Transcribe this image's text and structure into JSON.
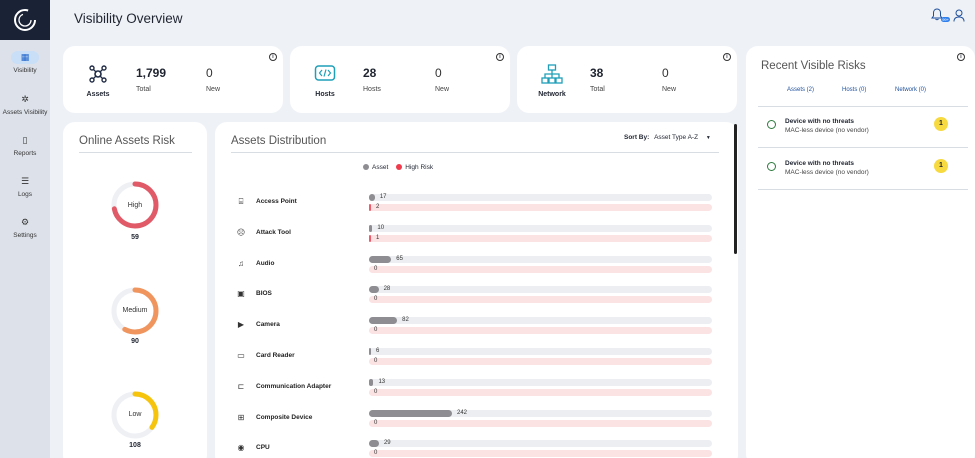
{
  "page": {
    "title": "Visibility Overview"
  },
  "sidebar": {
    "items": [
      {
        "label": "Visibility",
        "icon": "grid-icon"
      },
      {
        "label": "Assets Visibility",
        "icon": "asterisk-icon"
      },
      {
        "label": "Reports",
        "icon": "document-icon"
      },
      {
        "label": "Logs",
        "icon": "list-check-icon"
      },
      {
        "label": "Settings",
        "icon": "sliders-icon"
      }
    ]
  },
  "stats": [
    {
      "label": "Assets",
      "value": "1,799",
      "value_caption": "Total",
      "new_value": "0",
      "new_caption": "New"
    },
    {
      "label": "Hosts",
      "value": "28",
      "value_caption": "Hosts",
      "new_value": "0",
      "new_caption": "New"
    },
    {
      "label": "Network",
      "value": "38",
      "value_caption": "Total",
      "new_value": "0",
      "new_caption": "New"
    }
  ],
  "online_risk": {
    "title": "Online Assets Risk",
    "levels": [
      {
        "label": "High",
        "value": "59",
        "color": "#e05a67",
        "fraction": 0.72
      },
      {
        "label": "Medium",
        "value": "90",
        "color": "#f0955e",
        "fraction": 0.58
      },
      {
        "label": "Low",
        "value": "108",
        "color": "#f6c40d",
        "fraction": 0.35
      }
    ]
  },
  "distribution": {
    "title": "Assets Distribution",
    "sort_label": "Sort By:",
    "sort_value": "Asset Type A-Z",
    "legend": [
      {
        "label": "Asset",
        "color": "#8e8e92"
      },
      {
        "label": "High Risk",
        "color": "#ef3b4b"
      }
    ],
    "max_value": 1000,
    "rows": [
      {
        "name": "Access Point",
        "icon": "router-icon",
        "asset": "17",
        "risk": "2"
      },
      {
        "name": "Attack Tool",
        "icon": "hacker-icon",
        "asset": "10",
        "risk": "1"
      },
      {
        "name": "Audio",
        "icon": "headphones-icon",
        "asset": "65",
        "risk": "0"
      },
      {
        "name": "BIOS",
        "icon": "chip-icon",
        "asset": "28",
        "risk": "0"
      },
      {
        "name": "Camera",
        "icon": "camera-icon",
        "asset": "82",
        "risk": "0"
      },
      {
        "name": "Card Reader",
        "icon": "card-reader-icon",
        "asset": "6",
        "risk": "0"
      },
      {
        "name": "Communication Adapter",
        "icon": "adapter-icon",
        "asset": "13",
        "risk": "0"
      },
      {
        "name": "Composite Device",
        "icon": "composite-icon",
        "asset": "242",
        "risk": "0"
      },
      {
        "name": "CPU",
        "icon": "cpu-icon",
        "asset": "29",
        "risk": "0"
      }
    ]
  },
  "recent_risks": {
    "title": "Recent Visible Risks",
    "tabs": [
      "Assets (2)",
      "Hosts (0)",
      "Network (0)"
    ],
    "items": [
      {
        "title": "Device with no threats",
        "subtitle": "MAC-less device (no vendor)",
        "badge": "1"
      },
      {
        "title": "Device with no threats",
        "subtitle": "MAC-less device (no vendor)",
        "badge": "1"
      }
    ]
  },
  "header": {
    "notification_badge": "99+"
  }
}
